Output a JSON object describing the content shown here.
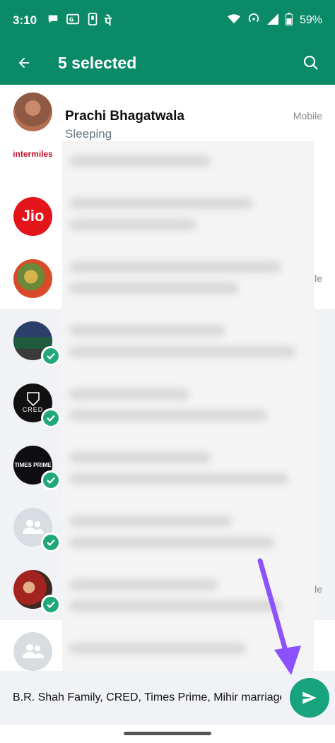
{
  "status": {
    "time": "3:10",
    "battery": "59%",
    "icons_left": [
      "chat-bubble-icon",
      "payment-icon",
      "phone-icon",
      "pe-icon"
    ],
    "icons_right": [
      "wifi-icon",
      "hotspot-icon",
      "signal-icon",
      "battery-icon"
    ]
  },
  "appbar": {
    "title": "5 selected",
    "back_icon": "arrow-left-icon",
    "search_icon": "search-icon"
  },
  "contacts": [
    {
      "name": "Prachi Bhagatwala",
      "sub": "Sleeping",
      "tag": "Mobile",
      "selected": false,
      "avatar": "photo"
    },
    {
      "name": "",
      "sub": "",
      "tag": "",
      "selected": false,
      "avatar": "intermiles",
      "logo_text": "intermiles"
    },
    {
      "name": "",
      "sub": "",
      "tag": "",
      "selected": false,
      "avatar": "jio",
      "logo_text": "Jio"
    },
    {
      "name": "",
      "sub": "",
      "tag": "ile",
      "selected": false,
      "avatar": "photo"
    },
    {
      "name": "",
      "sub": "",
      "tag": "",
      "selected": true,
      "avatar": "group-photo"
    },
    {
      "name": "",
      "sub": "",
      "tag": "",
      "selected": true,
      "avatar": "cred",
      "logo_text": "CRED"
    },
    {
      "name": "",
      "sub": "",
      "tag": "",
      "selected": true,
      "avatar": "timesprime",
      "logo_text": "TIMES PRIME"
    },
    {
      "name": "",
      "sub": "",
      "tag": "",
      "selected": true,
      "avatar": "group-default"
    },
    {
      "name": "",
      "sub": "",
      "tag": "ile",
      "selected": true,
      "avatar": "photo"
    },
    {
      "name": "",
      "sub": "",
      "tag": "",
      "selected": false,
      "avatar": "group-default"
    }
  ],
  "bottom": {
    "selected_names": "B.R. Shah Family, CRED, Times Prime, Mihir marriage"
  },
  "colors": {
    "brand": "#0b8a67",
    "check": "#20a77a",
    "send": "#17a37c",
    "arrow": "#8c52ff"
  }
}
